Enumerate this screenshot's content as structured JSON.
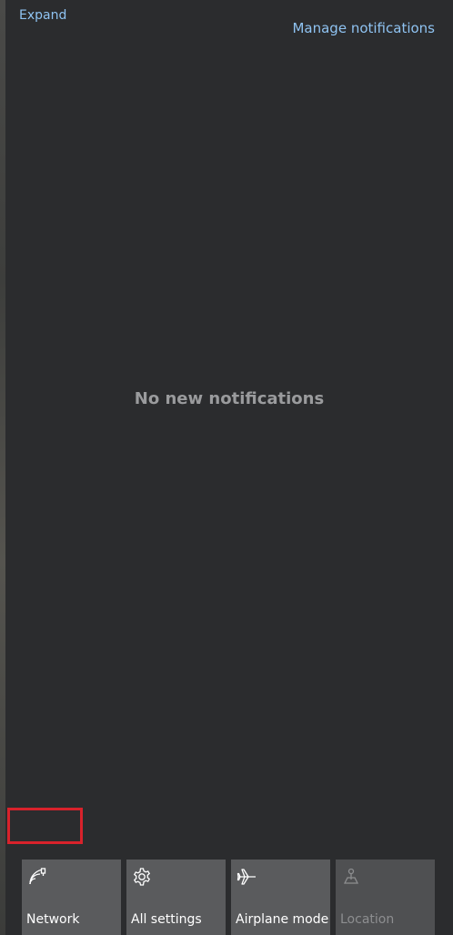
{
  "header": {
    "manage_label": "Manage notifications"
  },
  "notifications": {
    "empty_message": "No new notifications"
  },
  "footer": {
    "expand_label": "Expand"
  },
  "quick_actions": [
    {
      "label": "Network",
      "icon": "network-icon",
      "enabled": true
    },
    {
      "label": "All settings",
      "icon": "gear-icon",
      "enabled": true
    },
    {
      "label": "Airplane mode",
      "icon": "airplane-icon",
      "enabled": true
    },
    {
      "label": "Location",
      "icon": "location-icon",
      "enabled": false
    }
  ],
  "colors": {
    "panel_bg": "#2b2c2e",
    "link": "#8fc3f2",
    "tile_bg": "#5a5b5d",
    "highlight": "#d8222b"
  }
}
